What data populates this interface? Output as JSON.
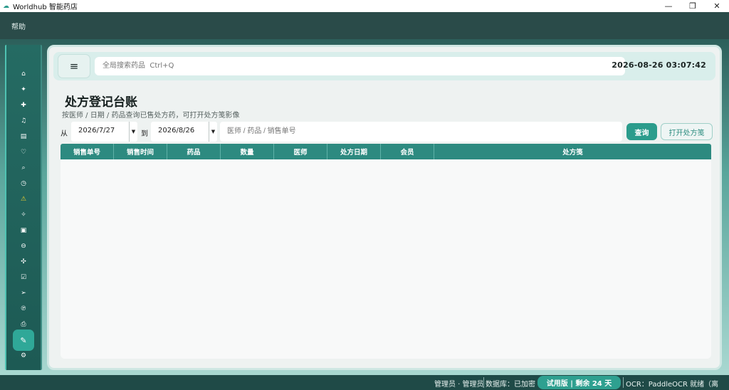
{
  "window": {
    "title": "Worldhub 智能药店",
    "controls": [
      "minimize",
      "restore",
      "close"
    ]
  },
  "menubar": {
    "items": [
      {
        "label": "帮助"
      }
    ]
  },
  "sidebar": {
    "icons": [
      "home-icon",
      "sparkle-icon",
      "plus-icon",
      "bell-icon",
      "clipboard-icon",
      "heart-icon",
      "search-icon",
      "clock-icon",
      "warning-icon",
      "star-icon",
      "box-icon",
      "pill-icon",
      "gear-icon",
      "edit-icon",
      "send-icon",
      "prescription-icon",
      "printer-icon",
      "prescription-ledger-icon",
      "settings-icon"
    ],
    "active_index": 17
  },
  "topbar": {
    "menu_glyph": "≡",
    "search_placeholder": "全局搜索药品  Ctrl+Q",
    "datetime": "2026-08-26  03:07:42"
  },
  "page": {
    "title": "处方登记台账",
    "subtitle": "按医师 / 日期 / 药品查询已售处方药，可打开处方笺影像"
  },
  "filters": {
    "from_label": "从",
    "from_date": "2026/7/27",
    "to_label": "到",
    "to_date": "2026/8/26",
    "keyword_placeholder": "医师 / 药品 / 销售单号",
    "query_button": "查询",
    "open_button": "打开处方笺"
  },
  "table": {
    "columns": [
      "销售单号",
      "销售时间",
      "药品",
      "数量",
      "医师",
      "处方日期",
      "会员",
      "处方笺"
    ],
    "rows": []
  },
  "statusbar": {
    "user": "管理员 · 管理员",
    "database": "数据库：已加密",
    "trial": "试用版 | 剩余 24 天",
    "ocr": "OCR：PaddleOCR 就绪（离线）"
  },
  "colors": {
    "accent": "#2b9c8c",
    "header": "#2d8a80",
    "warning": "#f2d22f",
    "dark_bg": "#1f4d4a"
  }
}
